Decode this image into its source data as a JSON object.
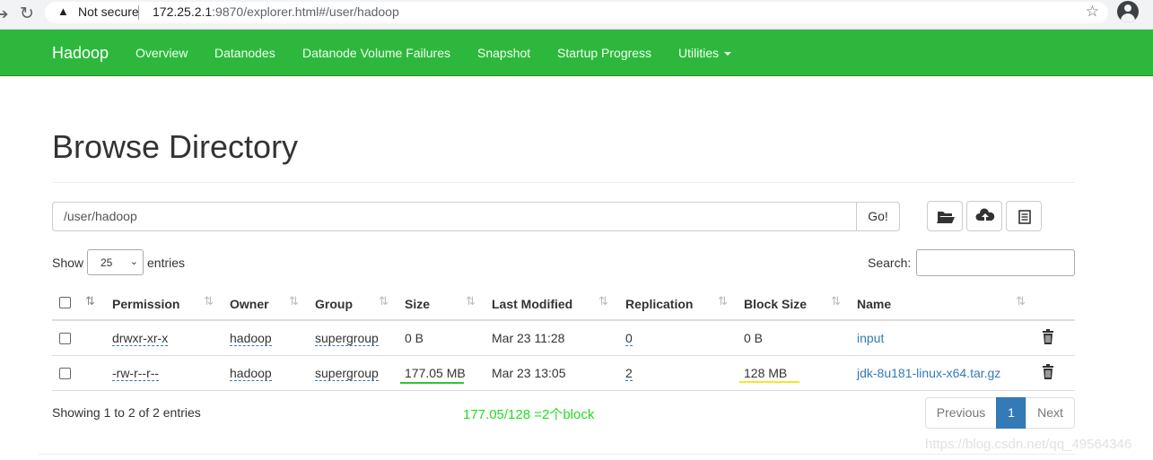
{
  "browser": {
    "security_label": "Not secure",
    "url_host": "172.25.2.1",
    "url_rest": ":9870/explorer.html#/user/hadoop"
  },
  "navbar": {
    "brand": "Hadoop",
    "items": [
      "Overview",
      "Datanodes",
      "Datanode Volume Failures",
      "Snapshot",
      "Startup Progress",
      "Utilities"
    ],
    "color": "#2db83d"
  },
  "page": {
    "title": "Browse Directory",
    "path_value": "/user/hadoop",
    "go_label": "Go!",
    "show_label": "Show",
    "entries_value": "25",
    "entries_label": "entries",
    "search_label": "Search:"
  },
  "table": {
    "headers": [
      "Permission",
      "Owner",
      "Group",
      "Size",
      "Last Modified",
      "Replication",
      "Block Size",
      "Name"
    ],
    "rows": [
      {
        "permission": "drwxr-xr-x",
        "owner": "hadoop",
        "group": "supergroup",
        "size": "0 B",
        "modified": "Mar 23 11:28",
        "replication": "0",
        "block_size": "0 B",
        "name": "input"
      },
      {
        "permission": "-rw-r--r--",
        "owner": "hadoop",
        "group": "supergroup",
        "size": "177.05 MB",
        "modified": "Mar 23 13:05",
        "replication": "2",
        "block_size": "128 MB",
        "name": "jdk-8u181-linux-x64.tar.gz"
      }
    ]
  },
  "footer": {
    "showing": "Showing 1 to 2 of 2 entries",
    "annotation": "177.05/128 =2个block",
    "previous": "Previous",
    "page": "1",
    "next": "Next",
    "watermark": "https://blog.csdn.net/qq_49564346"
  }
}
